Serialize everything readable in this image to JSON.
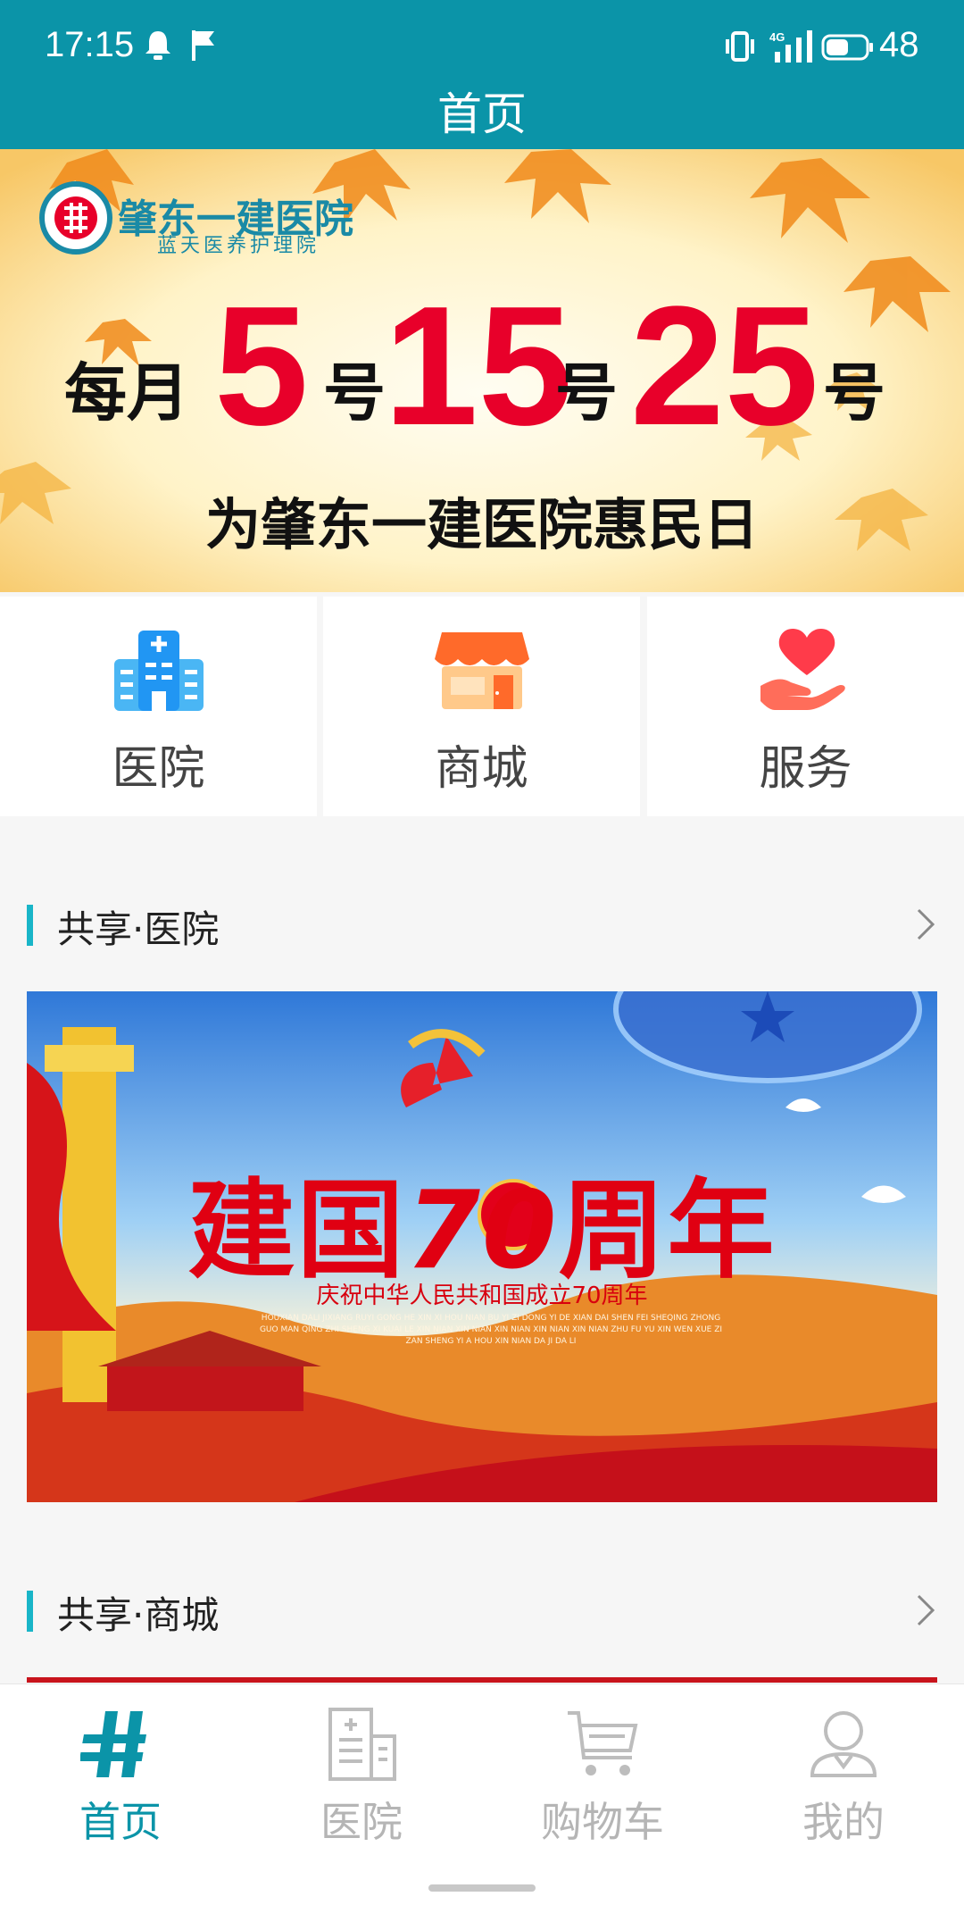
{
  "status_bar": {
    "time": "17:15",
    "battery": "48",
    "network": "4G"
  },
  "header": {
    "title": "首页"
  },
  "banner": {
    "hospital_name": "肇东一建医院",
    "hospital_sub": "蓝天医养护理院",
    "month_prefix": "每月",
    "day1": "5",
    "day2": "15",
    "day3": "25",
    "day_suffix": "号",
    "subtitle": "为肇东一建医院惠民日"
  },
  "quick_menu": [
    {
      "label": "医院",
      "icon": "hospital-icon"
    },
    {
      "label": "商城",
      "icon": "store-icon"
    },
    {
      "label": "服务",
      "icon": "heart-hand-icon"
    }
  ],
  "sections": {
    "hospital": {
      "title": "共享·医院"
    },
    "mall": {
      "title": "共享·商城"
    }
  },
  "anniversary": {
    "main_left": "建国",
    "main_num": "70",
    "main_right": "周年",
    "subtitle": "庆祝中华人民共和国成立70周年",
    "pinyin": "HOUXIAN DALI JIXIANG RUYI GONG HE XIN XI HOU NIAN BU YI ZI DONG YI DE XIAN DAI SHEN FEI SHEQING ZHONG GUO MAN QING ZHI SHENG XI KUAI LE XIN NIAN XIN NIAN XIN NIAN XIN NIAN XIN NIAN ZHU FU YU XIN WEN XUE ZI ZAN SHENG YI A HOU XIN NIAN DA JI DA LI"
  },
  "bottom_nav": [
    {
      "label": "首页",
      "icon": "home-logo-icon",
      "active": true
    },
    {
      "label": "医院",
      "icon": "building-icon",
      "active": false
    },
    {
      "label": "购物车",
      "icon": "cart-icon",
      "active": false
    },
    {
      "label": "我的",
      "icon": "user-icon",
      "active": false
    }
  ],
  "colors": {
    "primary": "#0b94a8",
    "accent_red": "#e8002a",
    "inactive": "#b5b5b5"
  }
}
